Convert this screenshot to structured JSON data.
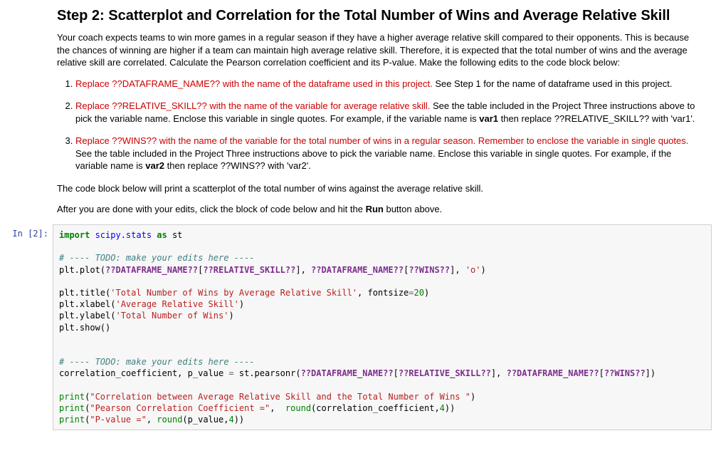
{
  "heading": "Step 2: Scatterplot and Correlation for the Total Number of Wins and Average Relative Skill",
  "intro": "Your coach expects teams to win more games in a regular season if they have a higher average relative skill compared to their opponents. This is because the chances of winning are higher if a team can maintain high average relative skill. Therefore, it is expected that the total number of wins and the average relative skill are correlated. Calculate the Pearson correlation coefficient and its P-value. Make the following edits to the code block below:",
  "li1_red": "Replace ??DATAFRAME_NAME?? with the name of the dataframe used in this project.",
  "li1_tail": " See Step 1 for the name of dataframe used in this project.",
  "li2_red": "Replace ??RELATIVE_SKILL?? with the name of the variable for average relative skill.",
  "li2_tail_a": " See the table included in the Project Three instructions above to pick the variable name. Enclose this variable in single quotes. For example, if the variable name is ",
  "li2_var": "var1",
  "li2_tail_b": " then replace ??RELATIVE_SKILL?? with 'var1'.",
  "li3_red": "Replace ??WINS?? with the name of the variable for the total number of wins in a regular season. Remember to enclose the variable in single quotes.",
  "li3_tail_a": " See the table included in the Project Three instructions above to pick the variable name. Enclose this variable in single quotes. For example, if the variable name is ",
  "li3_var": "var2",
  "li3_tail_b": " then replace ??WINS?? with 'var2'.",
  "scatter_line": "The code block below will print a scatterplot of the total number of wins against the average relative skill.",
  "run_line_a": "After you are done with your edits, click the block of code below and hit the ",
  "run_word": "Run",
  "run_line_b": " button above.",
  "prompt": "In [2]:",
  "code": {
    "l01_import": "import",
    "l01_scipy": " scipy.stats ",
    "l01_as": "as",
    "l01_st": " st",
    "l03_cmt": "# ---- TODO: make your edits here ----",
    "l04_a": "plt.plot(",
    "l04_ph1": "??DATAFRAME_NAME??",
    "l04_b": "[",
    "l04_ph2": "??RELATIVE_SKILL??",
    "l04_c": "], ",
    "l04_ph3": "??DATAFRAME_NAME??",
    "l04_d": "[",
    "l04_ph4": "??WINS??",
    "l04_e": "], ",
    "l04_str": "'o'",
    "l04_f": ")",
    "l06_a": "plt.title(",
    "l06_str": "'Total Number of Wins by Average Relative Skill'",
    "l06_b": ", fontsize",
    "l06_eq": "=",
    "l06_num": "20",
    "l06_c": ")",
    "l07_a": "plt.xlabel(",
    "l07_str": "'Average Relative Skill'",
    "l07_b": ")",
    "l08_a": "plt.ylabel(",
    "l08_str": "'Total Number of Wins'",
    "l08_b": ")",
    "l09": "plt.show()",
    "l12_cmt": "# ---- TODO: make your edits here ----",
    "l13_a": "correlation_coefficient, p_value ",
    "l13_eq": "=",
    "l13_b": " st.pearsonr(",
    "l13_ph1": "??DATAFRAME_NAME??",
    "l13_c": "[",
    "l13_ph2": "??RELATIVE_SKILL??",
    "l13_d": "], ",
    "l13_ph3": "??DATAFRAME_NAME??",
    "l13_e": "[",
    "l13_ph4": "??WINS??",
    "l13_f": "])",
    "l15_a": "print",
    "l15_p1": "(",
    "l15_str": "\"Correlation between Average Relative Skill and the Total Number of Wins \"",
    "l15_p2": ")",
    "l16_a": "print",
    "l16_p1": "(",
    "l16_str": "\"Pearson Correlation Coefficient =\"",
    "l16_b": ",  ",
    "l16_rnd": "round",
    "l16_c": "(correlation_coefficient,",
    "l16_n": "4",
    "l16_d": "))",
    "l17_a": "print",
    "l17_p1": "(",
    "l17_str": "\"P-value =\"",
    "l17_b": ", ",
    "l17_rnd": "round",
    "l17_c": "(p_value,",
    "l17_n": "4",
    "l17_d": "))"
  }
}
